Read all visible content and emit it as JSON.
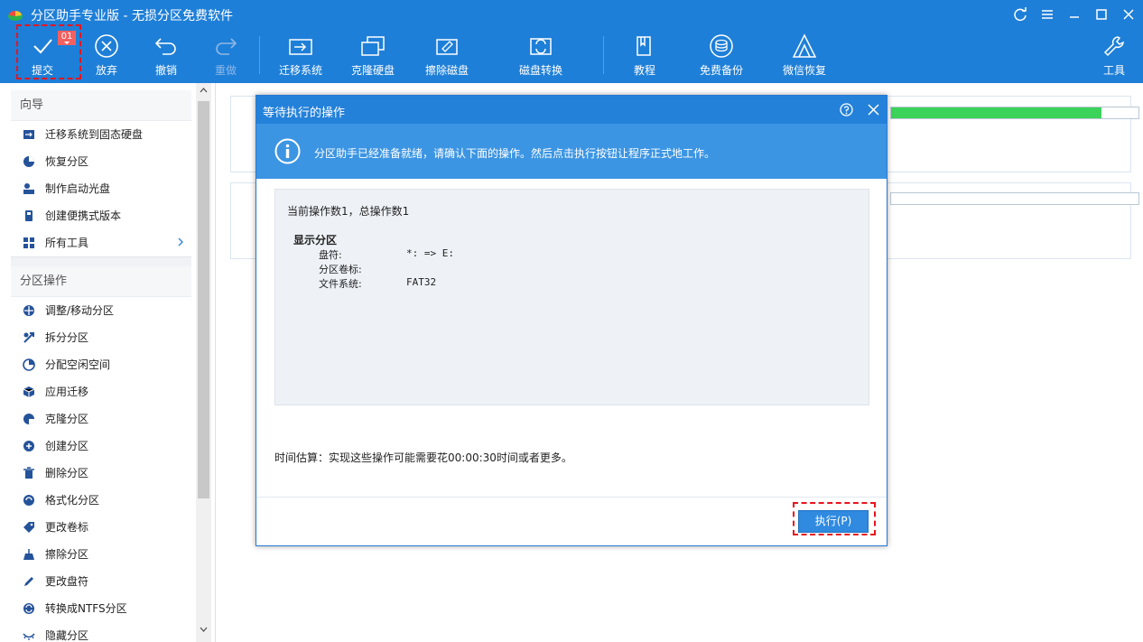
{
  "titlebar": {
    "title": "分区助手专业版 - 无损分区免费软件"
  },
  "toolbar": {
    "commit": {
      "label": "提交",
      "badge": "01"
    },
    "discard": {
      "label": "放弃"
    },
    "undo": {
      "label": "撤销"
    },
    "redo": {
      "label": "重做"
    },
    "migrate": {
      "label": "迁移系统"
    },
    "clone_disk": {
      "label": "克隆硬盘"
    },
    "wipe_disk": {
      "label": "擦除磁盘"
    },
    "disk_convert": {
      "label": "磁盘转换"
    },
    "tutorial": {
      "label": "教程"
    },
    "backup": {
      "label": "免费备份"
    },
    "wechat_recovery": {
      "label": "微信恢复"
    },
    "tools": {
      "label": "工具"
    }
  },
  "sidebar": {
    "wizard": {
      "header": "向导",
      "items": [
        {
          "label": "迁移系统到固态硬盘",
          "icon": "migrate-ssd-icon"
        },
        {
          "label": "恢复分区",
          "icon": "recover-partition-icon"
        },
        {
          "label": "制作启动光盘",
          "icon": "bootable-media-icon"
        },
        {
          "label": "创建便携式版本",
          "icon": "portable-version-icon"
        },
        {
          "label": "所有工具",
          "icon": "all-tools-icon"
        }
      ]
    },
    "partition_ops": {
      "header": "分区操作",
      "items": [
        {
          "label": "调整/移动分区",
          "icon": "resize-move-icon"
        },
        {
          "label": "拆分分区",
          "icon": "split-partition-icon"
        },
        {
          "label": "分配空闲空间",
          "icon": "allocate-space-icon"
        },
        {
          "label": "应用迁移",
          "icon": "app-mover-icon"
        },
        {
          "label": "克隆分区",
          "icon": "clone-partition-icon"
        },
        {
          "label": "创建分区",
          "icon": "create-partition-icon"
        },
        {
          "label": "删除分区",
          "icon": "delete-partition-icon"
        },
        {
          "label": "格式化分区",
          "icon": "format-partition-icon"
        },
        {
          "label": "更改卷标",
          "icon": "change-label-icon"
        },
        {
          "label": "擦除分区",
          "icon": "wipe-partition-icon"
        },
        {
          "label": "更改盘符",
          "icon": "change-letter-icon"
        },
        {
          "label": "转换成NTFS分区",
          "icon": "convert-ntfs-icon"
        },
        {
          "label": "隐藏分区",
          "icon": "hide-partition-icon"
        }
      ]
    }
  },
  "disk_cards": [
    {
      "usage_fraction": 0.85
    },
    {
      "usage_fraction": 0.0
    }
  ],
  "dialog": {
    "title": "等待执行的操作",
    "info": "分区助手已经准备就绪，请确认下面的操作。然后点击执行按钮让程序正式地工作。",
    "ops_count": "当前操作数1，总操作数1",
    "op_title": "显示分区",
    "fields": [
      {
        "key": "盘符:",
        "value": "*: => E:"
      },
      {
        "key": "分区卷标:",
        "value": ""
      },
      {
        "key": "文件系统:",
        "value": "FAT32"
      }
    ],
    "estimate": "时间估算：实现这些操作可能需要花00:00:30时间或者更多。",
    "execute_label": "执行(P)"
  },
  "colors": {
    "accent": "#1e7fd8",
    "highlight": "#e8141e",
    "usage_bar": "#3cd35a"
  }
}
